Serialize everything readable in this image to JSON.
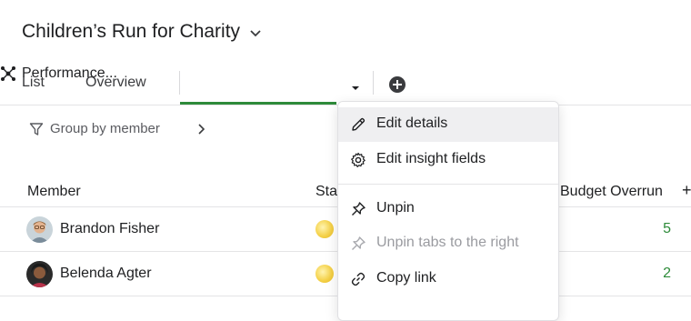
{
  "project": {
    "title": "Children’s Run for Charity"
  },
  "tabs": {
    "list": "List",
    "overview": "Overview",
    "active": "Performance..."
  },
  "toolbar": {
    "group_by": "Group by member"
  },
  "table": {
    "headers": {
      "member": "Member",
      "status": "Sta",
      "budget_overrun": "Budget Overrun",
      "add": "+"
    },
    "rows": [
      {
        "member": "Brandon Fisher",
        "budget_overrun": "5"
      },
      {
        "member": "Belenda Agter",
        "budget_overrun": "2"
      }
    ]
  },
  "menu": {
    "items": [
      {
        "label": "Edit details",
        "icon": "pencil-icon"
      },
      {
        "label": "Edit insight fields",
        "icon": "gear-icon"
      },
      {
        "label": "Unpin",
        "icon": "pin-icon"
      },
      {
        "label": "Unpin tabs to the right",
        "icon": "pin-icon"
      },
      {
        "label": "Copy link",
        "icon": "link-icon"
      }
    ]
  },
  "colors": {
    "accent_green": "#2e8b3a",
    "status_yellow": "#f5d24b"
  }
}
